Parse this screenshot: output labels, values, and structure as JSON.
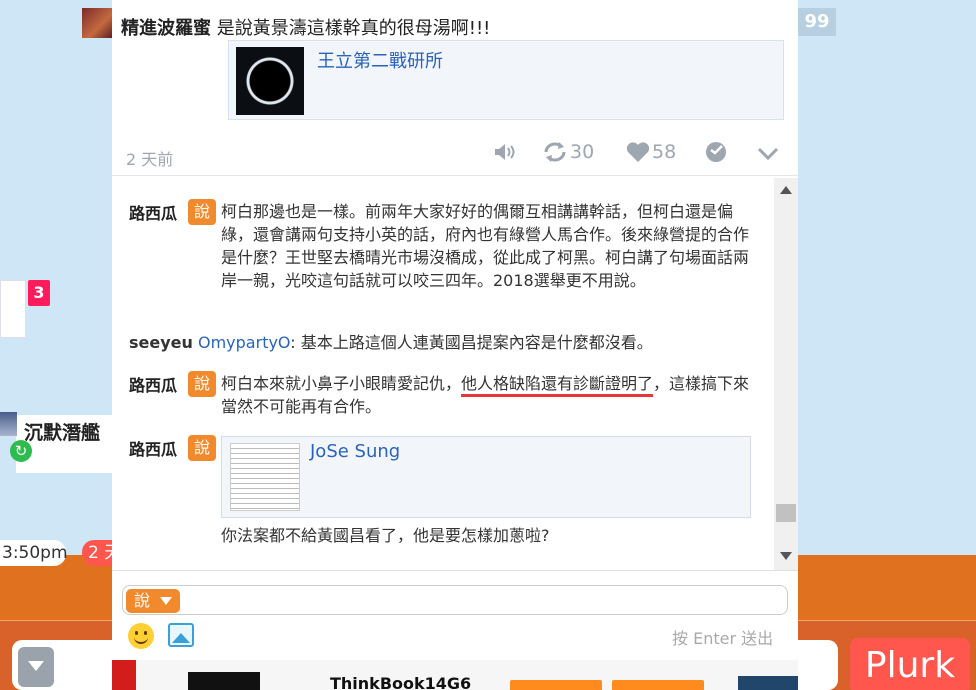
{
  "background": {
    "left_badge_count": "3",
    "left_user_name": "沉默潛艦",
    "left_time": "3:50pm",
    "left_time_2": "2 天",
    "top_count": "99",
    "plurk_button": "Plurk"
  },
  "plurk": {
    "owner": "精進波羅蜜",
    "content": "是說黃景濤這樣幹真的很母湯啊!!!",
    "link_title": "王立第二戰研所",
    "time": "2 天前",
    "replurk_count": "30",
    "like_count": "58"
  },
  "responses": [
    {
      "user": "路西瓜",
      "qualifier": "說",
      "text": "柯白那邊也是一樣。前兩年大家好好的偶爾互相講講幹話，但柯白還是偏綠，還會講兩句支持小英的話，府內也有綠營人馬合作。後來綠營提的合作是什麼？王世堅去橋晴光市場沒橋成，從此成了柯黑。柯白講了句場面話兩岸一親，光咬這句話就可以咬三四年。2018選舉更不用說。"
    },
    {
      "user": "seeyeu",
      "mention": "OmypartyO",
      "text": ": 基本上路這個人連黃國昌提案內容是什麼都沒看。"
    },
    {
      "user": "路西瓜",
      "qualifier": "說",
      "text_before": "柯白本來就小鼻子小眼睛愛記仇，",
      "text_underlined": "他人格缺陷還有診斷證明了",
      "text_after": "，這樣搞下來當然不可能再有合作。"
    },
    {
      "user": "路西瓜",
      "qualifier": "說",
      "embed_title": "JoSe Sung",
      "text": "你法案都不給黃國昌看了，他是要怎樣加蔥啦?"
    }
  ],
  "reply": {
    "qualifier": "說",
    "send_hint": "按 Enter 送出"
  },
  "ad": {
    "text": "ThinkBook14G6"
  }
}
